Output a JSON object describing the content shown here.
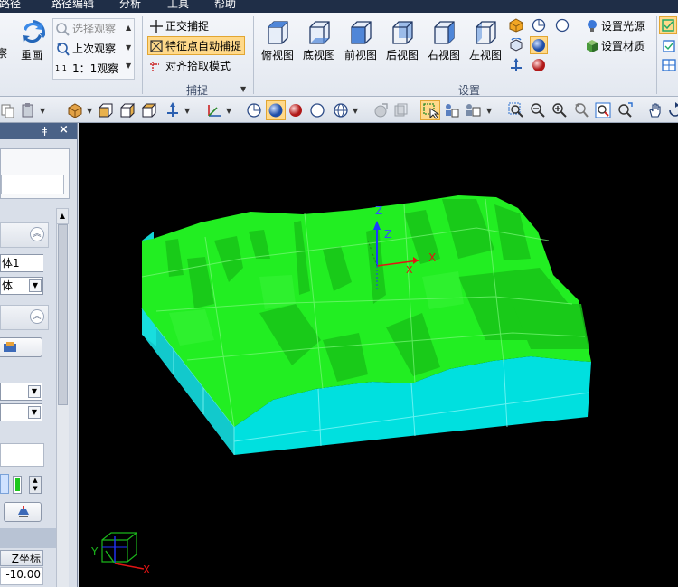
{
  "menu": [
    "路径",
    "路径编辑",
    "分析",
    "工具",
    "帮助"
  ],
  "ribbon": {
    "view_group": {
      "cut_label": "察",
      "redraw_label": "重画",
      "select_view_label": "选择观察",
      "prev_view_label": "上次观察",
      "one_to_one_label": "1：1观察"
    },
    "capture_group": {
      "title": "捕捉",
      "ortho_capture_label": "正交捕捉",
      "feature_point_label": "特征点自动捕捉",
      "align_pick_label": "对齐拾取模式"
    },
    "settings_group": {
      "title": "设置",
      "views": [
        "俯视图",
        "底视图",
        "前视图",
        "后视图",
        "右视图",
        "左视图"
      ],
      "light_label": "设置光源",
      "material_label": "设置材质"
    }
  },
  "left_panel": {
    "field1_value": "体1",
    "field2_value": "体",
    "zcoord_header": "Z坐标",
    "zcoord_value": "-10.00"
  },
  "viewport": {
    "axis_z": "Z",
    "axis_x": "X",
    "axis_y": "Y",
    "triad_x": "X",
    "triad_y": "Y",
    "background": "#000000",
    "surface_color": "#22ee22",
    "side_color": "#00e5e5"
  }
}
